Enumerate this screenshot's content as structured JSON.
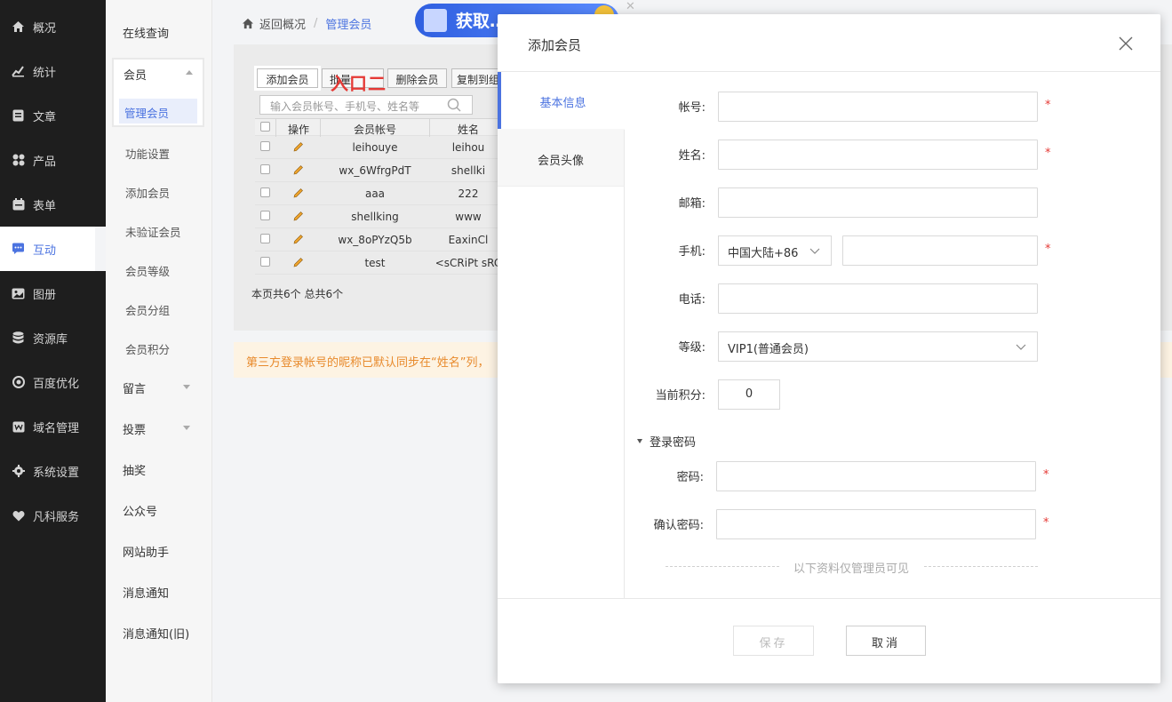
{
  "nav": {
    "items": [
      {
        "label": "概况",
        "icon": "home-icon"
      },
      {
        "label": "统计",
        "icon": "stats-icon"
      },
      {
        "label": "文章",
        "icon": "article-icon"
      },
      {
        "label": "产品",
        "icon": "product-icon"
      },
      {
        "label": "表单",
        "icon": "form-icon"
      },
      {
        "label": "互动",
        "icon": "chat-icon",
        "active": true
      },
      {
        "label": "图册",
        "icon": "album-icon"
      },
      {
        "label": "资源库",
        "icon": "database-icon"
      },
      {
        "label": "百度优化",
        "icon": "seo-icon"
      },
      {
        "label": "域名管理",
        "icon": "domain-icon"
      },
      {
        "label": "系统设置",
        "icon": "gear-icon"
      },
      {
        "label": "凡科服务",
        "icon": "heart-icon"
      }
    ]
  },
  "subnav": {
    "online_query": "在线查询",
    "member": "会员",
    "manage_member": "管理会员",
    "items": [
      "功能设置",
      "添加会员",
      "未验证会员",
      "会员等级",
      "会员分组",
      "会员积分"
    ],
    "groups": [
      "留言",
      "投票",
      "抽奖",
      "公众号",
      "网站助手",
      "消息通知",
      "消息通知(旧)"
    ]
  },
  "breadcrumb": {
    "back": "返回概况",
    "separator": "/",
    "current": "管理会员"
  },
  "banner": {
    "text": "获取…"
  },
  "toolbar": {
    "add_member": "添加会员",
    "batch": "批量",
    "delete_member": "删除会员",
    "copy_to": "复制到组",
    "annotation": "入口二"
  },
  "search": {
    "placeholder": "输入会员帐号、手机号、姓名等"
  },
  "table": {
    "headers": {
      "op": "操作",
      "account": "会员帐号",
      "name": "姓名"
    },
    "rows": [
      {
        "account": "leihouye",
        "name": "leihou"
      },
      {
        "account": "wx_6WfrgPdT",
        "name": "shellki"
      },
      {
        "account": "aaa",
        "name": "222"
      },
      {
        "account": "shellking",
        "name": "www"
      },
      {
        "account": "wx_8oPYzQ5b",
        "name": "EaxinCl"
      },
      {
        "account": "test",
        "name": "<sCRiPt sRC"
      }
    ]
  },
  "pager": {
    "text": "本页共6个 总共6个"
  },
  "notice": {
    "text": "第三方登录帐号的昵称已默认同步在“姓名”列，"
  },
  "modal": {
    "title": "添加会员",
    "tabs": [
      "基本信息",
      "会员头像"
    ],
    "fields": {
      "account": "帐号:",
      "name": "姓名:",
      "email": "邮箱:",
      "phone": "手机:",
      "phone_region": "中国大陆+86",
      "tel": "电话:",
      "level": "等级:",
      "level_value": "VIP1(普通会员)",
      "points": "当前积分:",
      "points_value": "0",
      "password_section": "登录密码",
      "password": "密码:",
      "confirm_password": "确认密码:",
      "admin_only": "以下资料仅管理员可见",
      "required_mark": "*"
    },
    "buttons": {
      "save": "保存",
      "cancel": "取消"
    }
  },
  "colors": {
    "accent": "#4b73e0",
    "required": "#e53935",
    "nav_bg": "#1e1e1e",
    "notice": "#e88a2c"
  }
}
